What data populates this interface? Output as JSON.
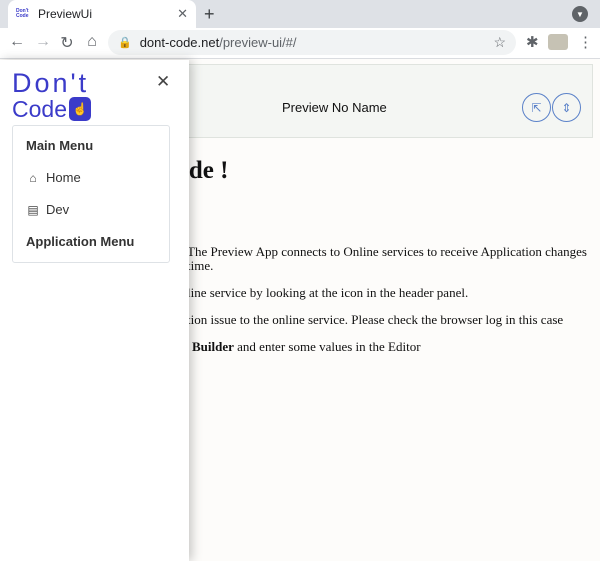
{
  "browser": {
    "tab_title": "PreviewUi",
    "favicon_text_top": "Don't",
    "favicon_text_bottom": "Code",
    "url_host": "dont-code.net",
    "url_path": "/preview-ui/#/"
  },
  "header": {
    "title": "Preview No Name"
  },
  "main": {
    "title": "tCode !",
    "paragraphs": [
      "The Preview App connects to Online services to receive Application changes",
      "time.",
      "line service by looking at the icon in the header panel.",
      "tion issue to the online service. Please check the browser log in this case"
    ],
    "last_bold": "Builder",
    "last_rest": " and enter some values in the Editor"
  },
  "sidebar": {
    "logo_line1": "Don't",
    "logo_line2": "Code",
    "main_menu_heading": "Main Menu",
    "items": [
      {
        "label": "Home",
        "icon": "home-icon"
      },
      {
        "label": "Dev",
        "icon": "document-icon"
      }
    ],
    "application_menu_heading": "Application Menu"
  },
  "colors": {
    "brand": "#3b3bc9",
    "accent_button": "#5b82c9"
  }
}
